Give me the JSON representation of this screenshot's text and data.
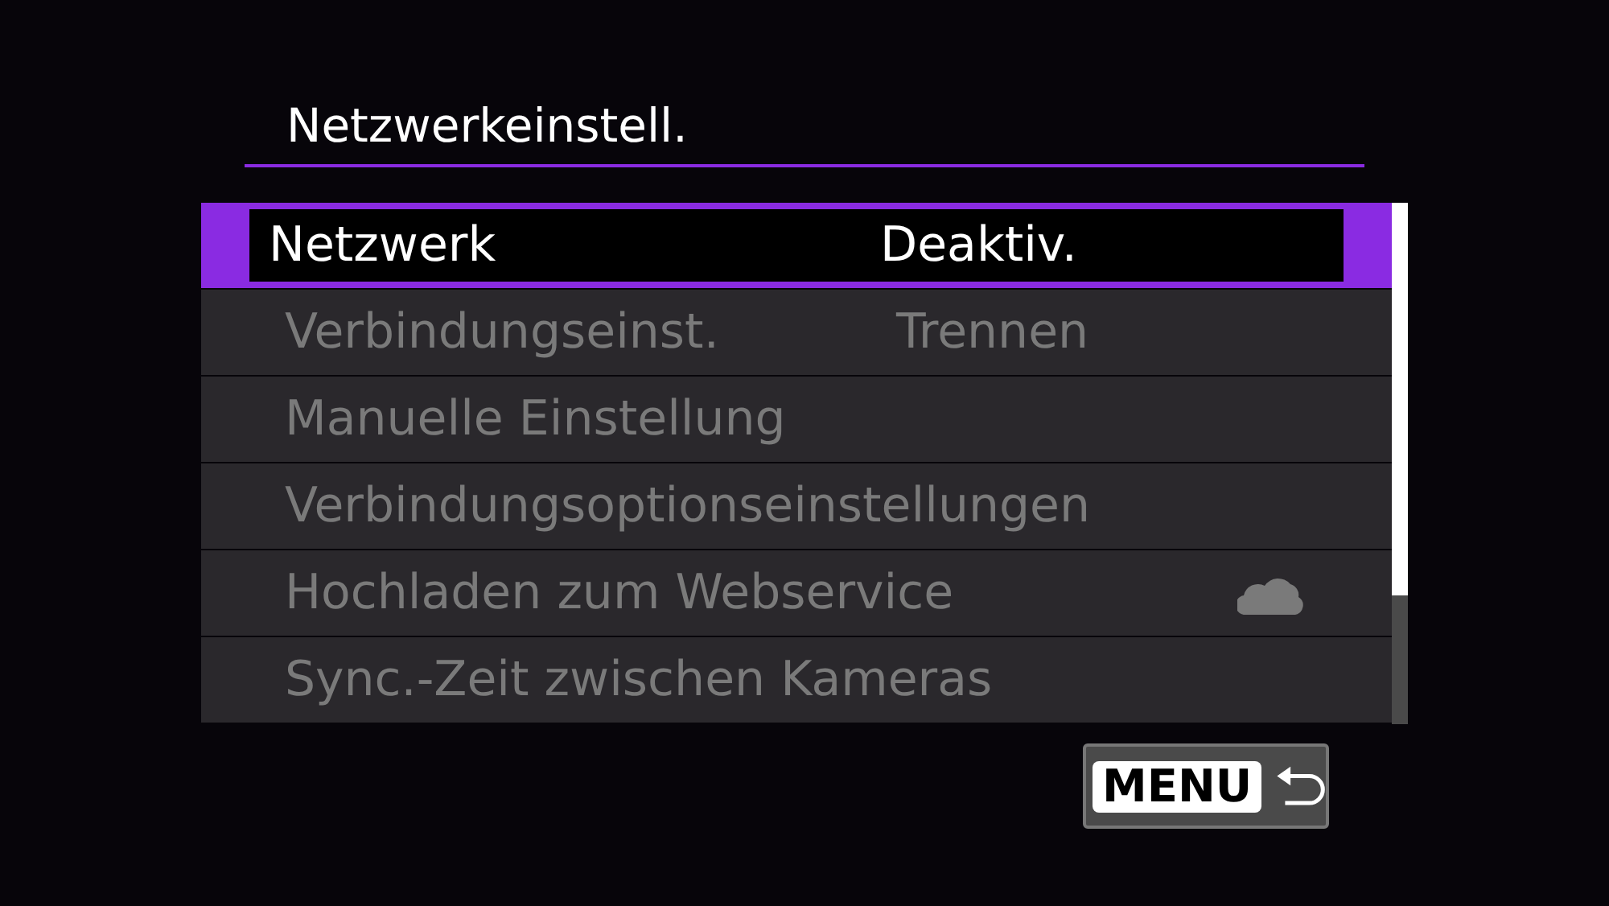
{
  "title": "Netzwerkeinstell.",
  "items": [
    {
      "label": "Netzwerk",
      "value": "Deaktiv.",
      "kind": "plain",
      "selected": true,
      "disabled": false
    },
    {
      "label": "Verbindungseinst.",
      "value": "Trennen",
      "kind": "plain",
      "selected": false,
      "disabled": true
    },
    {
      "label": "Manuelle Einstellung",
      "kind": "plain",
      "selected": false,
      "disabled": true
    },
    {
      "label": "Verbindungsoptionseinstellungen",
      "kind": "plain",
      "selected": false,
      "disabled": true
    },
    {
      "label": "Hochladen zum Webservice",
      "kind": "cloud",
      "selected": false,
      "disabled": true
    },
    {
      "label": "Sync.-Zeit zwischen Kameras",
      "kind": "plain",
      "selected": false,
      "disabled": true
    }
  ],
  "back_button": {
    "label": "MENU"
  }
}
